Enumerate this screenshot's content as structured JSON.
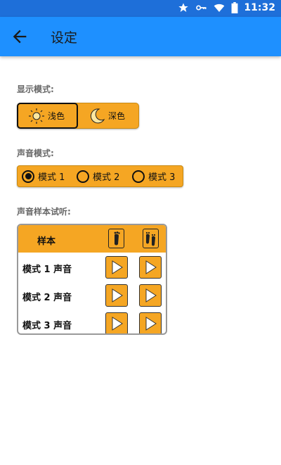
{
  "status": {
    "time": "11:32"
  },
  "app_bar": {
    "title": "设定"
  },
  "display_mode": {
    "label": "显示模式:",
    "options": [
      {
        "label": "浅色",
        "selected": true
      },
      {
        "label": "深色",
        "selected": false
      }
    ]
  },
  "sound_mode": {
    "label": "声音模式:",
    "options": [
      {
        "label": "模式 1",
        "selected": true
      },
      {
        "label": "模式 2",
        "selected": false
      },
      {
        "label": "模式 3",
        "selected": false
      }
    ]
  },
  "sound_sample": {
    "label": "声音样本试听:",
    "header": "样本",
    "rows": [
      {
        "label": "模式 1 声音"
      },
      {
        "label": "模式 2 声音"
      },
      {
        "label": "模式 3 声音"
      }
    ]
  },
  "colors": {
    "accent": "#f5a623",
    "app_bar": "#1e90ff",
    "status_bar": "#1e6fd9"
  }
}
